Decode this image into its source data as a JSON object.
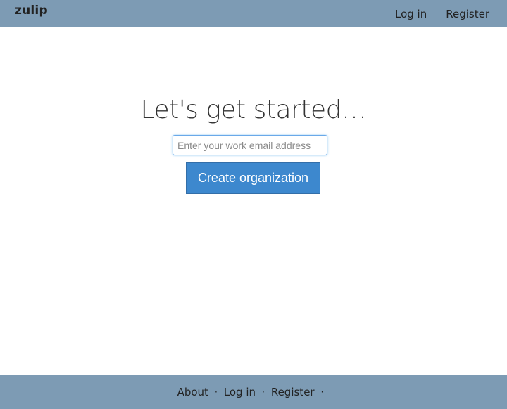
{
  "header": {
    "brand": "zulip",
    "nav": [
      "Log in",
      "Register"
    ]
  },
  "main": {
    "heading": "Let's get started…",
    "email_placeholder": "Enter your work email address",
    "email_value": "",
    "button_label": "Create organization"
  },
  "footer": {
    "links": [
      "About",
      "Log in",
      "Register"
    ],
    "separator": "·"
  },
  "colors": {
    "bar": "#7d9bb4",
    "accent": "#3d88ce"
  }
}
